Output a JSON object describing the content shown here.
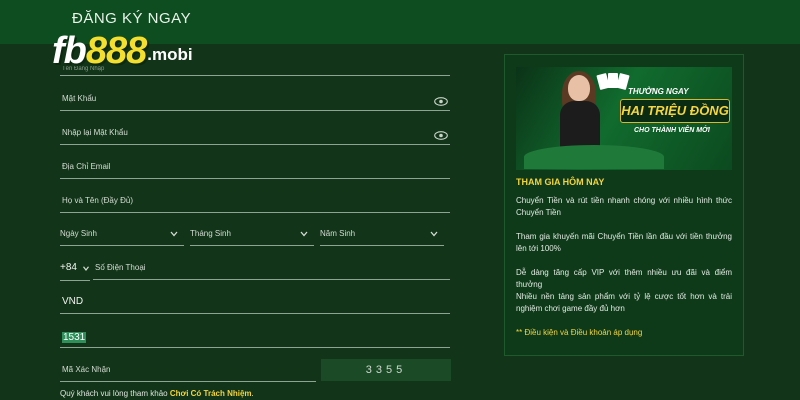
{
  "header": {
    "title": "ĐĂNG KÝ NGAY",
    "logo_prefix": "fb",
    "logo_number": "888",
    "logo_domain": ".mobi"
  },
  "form": {
    "username_label": "Tên Đăng Nhập",
    "password_label": "Mật Khẩu",
    "confirm_password_label": "Nhập lại Mật Khẩu",
    "email_label": "Địa Chỉ Email",
    "fullname_label": "Họ và Tên (Đầy Đủ)",
    "dob_day_label": "Ngày Sinh",
    "dob_month_label": "Tháng Sinh",
    "dob_year_label": "Năm Sinh",
    "phone_prefix": "+84",
    "phone_label": "Số Điện Thoại",
    "currency_value": "VND",
    "code_value": "1531",
    "captcha_label": "Mã Xác Nhận",
    "captcha_code": "3355",
    "footer_text": "Quý khách vui lòng tham khảo ",
    "footer_link": "Chơi Có Trách Nhiệm",
    "footer_end": "."
  },
  "promo": {
    "banner_line1": "THƯỞNG NGAY",
    "banner_line2": "HAI TRIỆU ĐỒNG",
    "banner_line3": "CHO THÀNH VIÊN MỚI",
    "title": "THAM GIA HÔM NAY",
    "items": [
      "Chuyển Tiền và rút tiền nhanh chóng với nhiều hình thức Chuyển Tiền",
      "Tham gia khuyến mãi Chuyển Tiền lần đầu với tiền thưởng lên tới 100%",
      "Dễ dàng tăng cấp VIP với thêm nhiều ưu đãi và điểm thưởng",
      "Nhiều nền tảng sản phẩm với tỷ lệ cược tốt hơn và trải nghiệm chơi game đầy đủ hơn"
    ],
    "terms": "** Điều kiện và Điều khoản áp dụng"
  },
  "colors": {
    "background": "#123418",
    "header": "#0d4d1f",
    "accent_yellow": "#f2d53c",
    "code_highlight": "#2e8f5a"
  }
}
